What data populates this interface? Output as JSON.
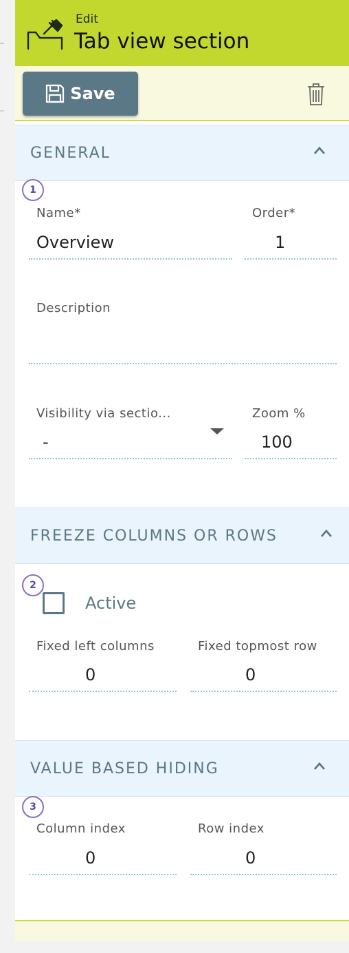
{
  "header": {
    "edit_label": "Edit",
    "title": "Tab view section",
    "background": "#c3d82e"
  },
  "toolbar": {
    "save_label": "Save",
    "save_icon": "floppy-disk-icon",
    "delete_icon": "trash-icon"
  },
  "sections": {
    "general": {
      "title": "GENERAL",
      "badge": "1",
      "name_label": "Name*",
      "name_value": "Overview",
      "order_label": "Order*",
      "order_value": "1",
      "description_label": "Description",
      "description_value": "",
      "visibility_label": "Visibility via sectio...",
      "visibility_value": "-",
      "zoom_label": "Zoom %",
      "zoom_value": "100"
    },
    "freeze": {
      "title": "FREEZE COLUMNS OR ROWS",
      "badge": "2",
      "active_label": "Active",
      "active_checked": false,
      "fixed_left_label": "Fixed left columns",
      "fixed_left_value": "0",
      "fixed_top_label": "Fixed topmost row",
      "fixed_top_value": "0"
    },
    "value_hiding": {
      "title": "VALUE BASED HIDING",
      "badge": "3",
      "column_index_label": "Column index",
      "column_index_value": "0",
      "row_index_label": "Row index",
      "row_index_value": "0"
    }
  },
  "colors": {
    "accent": "#c3d82e",
    "button": "#5b7886",
    "section_bg": "#eaf4fc",
    "badge_border": "#8a6fc4"
  }
}
